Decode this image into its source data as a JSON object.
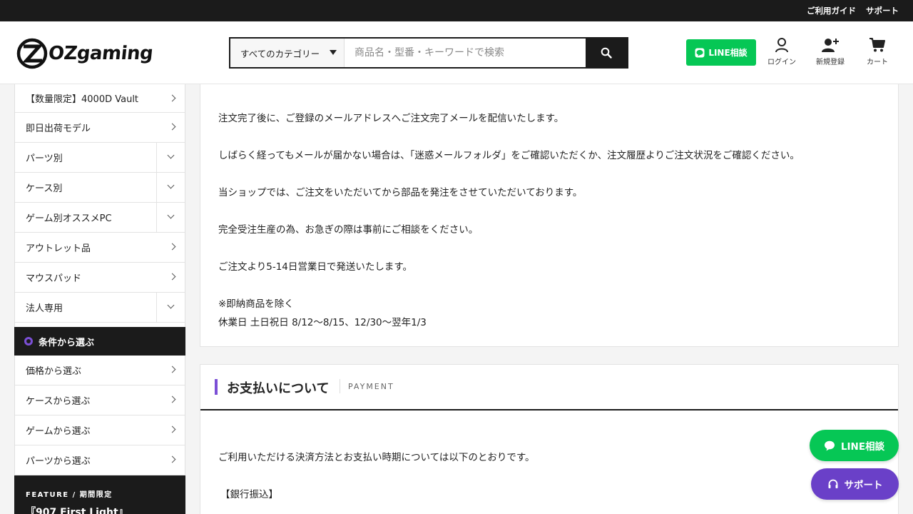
{
  "topbar": {
    "guide": "ご利用ガイド",
    "support": "サポート"
  },
  "brand": {
    "name": "OZgaming"
  },
  "search": {
    "category": "すべてのカテゴリー",
    "placeholder": "商品名・型番・キーワードで検索",
    "value": ""
  },
  "header_actions": {
    "line": "LINE相談",
    "login": "ログイン",
    "register": "新規登録",
    "cart": "カート"
  },
  "sidebar": {
    "items": [
      {
        "label": "【数量限定】4000D Vault",
        "type": "link"
      },
      {
        "label": "即日出荷モデル",
        "type": "link"
      },
      {
        "label": "パーツ別",
        "type": "expand"
      },
      {
        "label": "ケース別",
        "type": "expand"
      },
      {
        "label": "ゲーム別オススメPC",
        "type": "expand"
      },
      {
        "label": "アウトレット品",
        "type": "link"
      },
      {
        "label": "マウスパッド",
        "type": "link"
      },
      {
        "label": "法人専用",
        "type": "expand"
      }
    ],
    "conditions_heading": "条件から選ぶ",
    "conditions": [
      {
        "label": "価格から選ぶ"
      },
      {
        "label": "ケースから選ぶ"
      },
      {
        "label": "ゲームから選ぶ"
      },
      {
        "label": "パーツから選ぶ"
      }
    ],
    "feature": {
      "tag": "FEATURE / 期間限定",
      "title": "『907 First Light』"
    }
  },
  "order_section": {
    "paragraphs": [
      "注文完了後に、ご登録のメールアドレスへご注文完了メールを配信いたします。",
      "しばらく経ってもメールが届かない場合は、「迷惑メールフォルダ」をご確認いただくか、注文履歴よりご注文状況をご確認ください。",
      "当ショップでは、ご注文をいただいてから部品を発注をさせていただいております。",
      "完全受注生産の為、お急ぎの際は事前にご相談をください。",
      "ご注文より5-14日営業日で発送いたします。",
      "※即納商品を除く",
      "休業日 土日祝日 8/12〜8/15、12/30〜翌年1/3"
    ]
  },
  "payment_section": {
    "title": "お支払いについて",
    "title_en": "PAYMENT",
    "paragraphs": [
      "ご利用いただける決済方法とお支払い時期については以下のとおりです。",
      "【銀行振込】"
    ]
  },
  "floating": {
    "line": "LINE相談",
    "support": "サポート"
  },
  "colors": {
    "accent": "#7b4fd6",
    "line_green": "#06c755",
    "dark": "#1b1b1b",
    "support_purple": "#6a40c8"
  }
}
